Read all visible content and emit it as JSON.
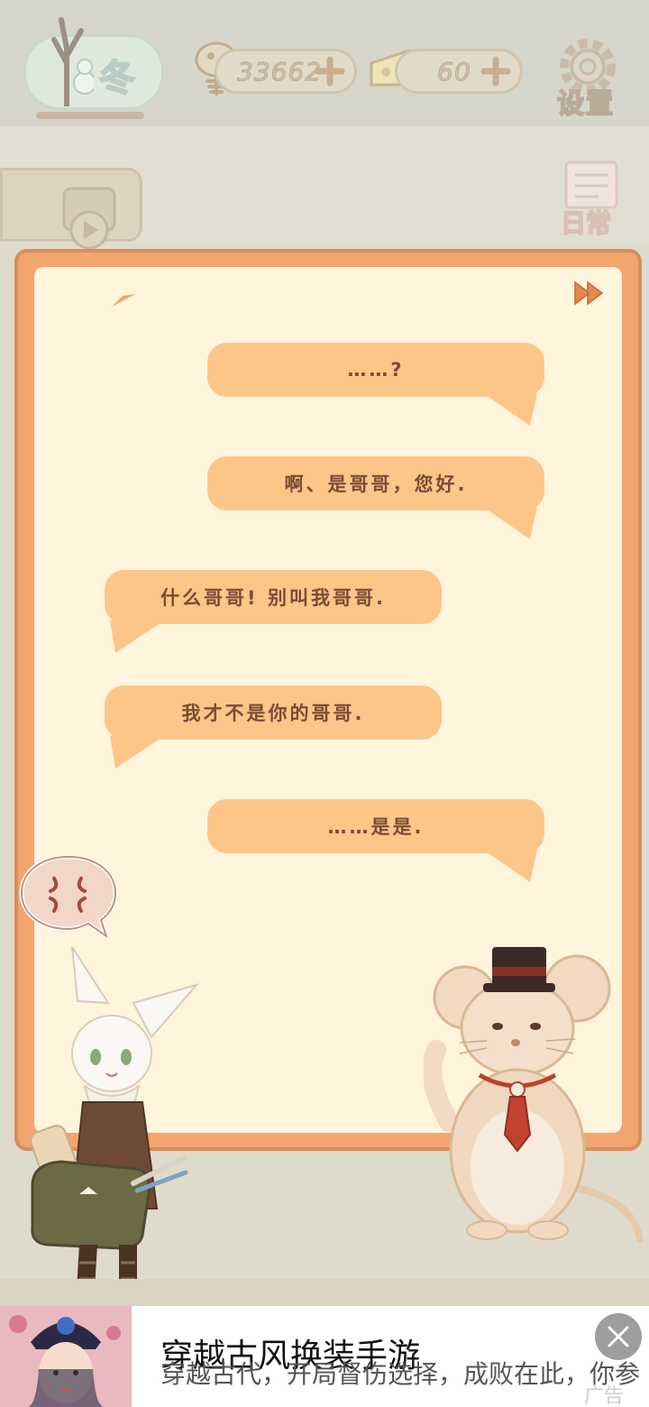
{
  "hud": {
    "season": {
      "label": "冬",
      "progress": 1.0
    },
    "fish_count": "33662",
    "cheese_count": "60",
    "settings_label": "设置"
  },
  "side": {
    "daily_label": "日常"
  },
  "dialogue": {
    "messages": [
      {
        "speaker": "mouse",
        "side": "right",
        "text": "……?"
      },
      {
        "speaker": "mouse",
        "side": "right",
        "text": "啊、是哥哥，您好."
      },
      {
        "speaker": "fox",
        "side": "left",
        "text": "什么哥哥! 别叫我哥哥."
      },
      {
        "speaker": "fox",
        "side": "left",
        "text": "我才不是你的哥哥."
      },
      {
        "speaker": "mouse",
        "side": "right",
        "text": "……是是."
      }
    ]
  },
  "ad": {
    "title": "穿越古风换装手游",
    "description": "穿越古代，开局督伤选择，成败在此，你参",
    "tag": "广告"
  },
  "colors": {
    "board_border": "#f2a56e",
    "bubble": "#fdc689",
    "bubble_text": "#7b4b36",
    "paper": "#fff4dc"
  }
}
